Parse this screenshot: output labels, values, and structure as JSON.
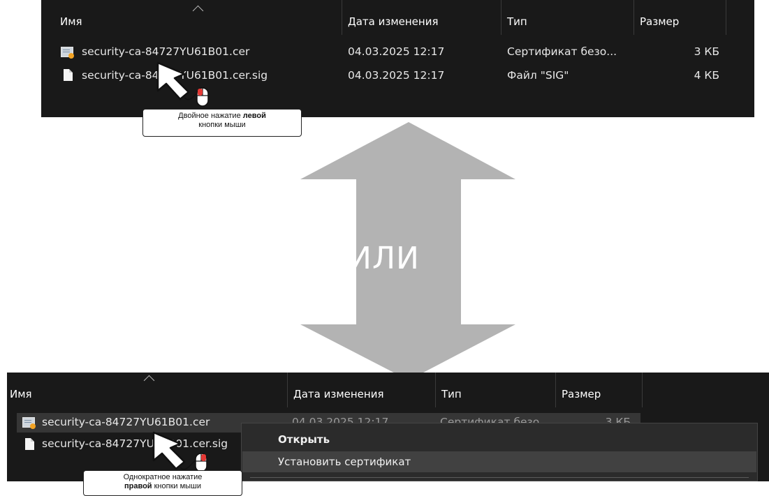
{
  "columns": {
    "name": "Имя",
    "date": "Дата изменения",
    "type": "Тип",
    "size": "Размер"
  },
  "top": {
    "files": [
      {
        "name": "security-ca-84727YU61B01.cer",
        "date": "04.03.2025 12:17",
        "type": "Сертификат безо...",
        "size": "3 КБ",
        "icon": "certificate-icon"
      },
      {
        "name": "security-ca-84727YU61B01.cer.sig",
        "date": "04.03.2025 12:17",
        "type": "Файл \"SIG\"",
        "size": "4 КБ",
        "icon": "file-icon"
      }
    ],
    "callout": {
      "text_pre": "Двойное нажатие ",
      "text_bold": "левой",
      "text_post": "кнопки мыши"
    }
  },
  "or_label": "ИЛИ",
  "bottom": {
    "files": [
      {
        "name": "security-ca-84727YU61B01.cer",
        "date": "04.03.2025 12:17",
        "type": "Сертификат безо...",
        "size": "3 КБ",
        "icon": "certificate-icon"
      },
      {
        "name": "security-ca-84727YU61B01.cer.sig",
        "icon": "file-icon"
      }
    ],
    "context_menu": {
      "open": "Открыть",
      "install": "Установить сертификат"
    },
    "callout": {
      "text_pre": "Однократное нажатие",
      "text_bold": "правой",
      "text_post": " кнопки мыши"
    }
  },
  "colors": {
    "explorer_bg": "#191919",
    "arrow": "#b3b3b3",
    "menu_bg": "#2b2b2b"
  }
}
